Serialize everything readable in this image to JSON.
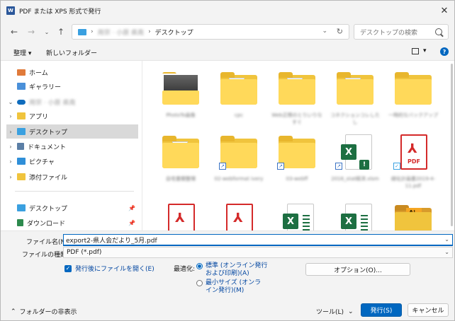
{
  "window": {
    "title": "PDF または XPS 形式で発行",
    "app_icon_letter": "W"
  },
  "nav": {
    "address_segments": [
      "用宗 · 小原 県南",
      "デスクトップ"
    ],
    "search_placeholder": "デスクトップの検索"
  },
  "toolbar": {
    "organize_label": "整理 ▾",
    "new_folder_label": "新しいフォルダー"
  },
  "sidebar": {
    "items": [
      {
        "label": "ホーム"
      },
      {
        "label": "ギャラリー"
      },
      {
        "label": "用宗 · 小原 県南"
      },
      {
        "label": "アプリ"
      },
      {
        "label": "デスクトップ"
      },
      {
        "label": "ドキュメント"
      },
      {
        "label": "ピクチャ"
      },
      {
        "label": "添付ファイル"
      },
      {
        "label": "デスクトップ"
      },
      {
        "label": "ダウンロード"
      }
    ]
  },
  "files": [
    {
      "label": "PhotoTo画像"
    },
    {
      "label": "cpc"
    },
    {
      "label": "Web正際のとりいりなすぐ"
    },
    {
      "label": "コネクションコレしたし"
    },
    {
      "label": "一時的なバックアップ"
    },
    {
      "label": "自宅書類整理"
    },
    {
      "label": "02-webformat ivery"
    },
    {
      "label": "03-webff"
    },
    {
      "label": "2016_stat経済.xlsm"
    },
    {
      "label": "緑化計画書2019-4-11.pdf"
    },
    {
      "label": ""
    },
    {
      "label": ""
    },
    {
      "label": ""
    },
    {
      "label": ""
    },
    {
      "label": ""
    }
  ],
  "pdf_text": "PDF",
  "form": {
    "filename_label": "ファイル名(N):",
    "filename_value": "export2-県人会だより_5月.pdf",
    "filetype_label": "ファイルの種類(T):",
    "filetype_value": "PDF (*.pdf)",
    "open_after_label": "発行後にファイルを開く(E)",
    "optimize_label": "最適化:",
    "radio_standard_label": "標準 (オンライン発行および印刷)(A)",
    "radio_minimum_label": "最小サイズ (オンライン発行)(M)",
    "options_button": "オプション(O)..."
  },
  "footer": {
    "hide_folders_label": "フォルダーの非表示",
    "tools_label": "ツール(L)",
    "publish_button": "発行(S)",
    "cancel_button": "キャンセル"
  },
  "colors": {
    "accent": "#0067c0",
    "folder": "#ffd95a",
    "excel": "#1d6f42",
    "pdf": "#d42a2a",
    "word": "#2b579a"
  }
}
